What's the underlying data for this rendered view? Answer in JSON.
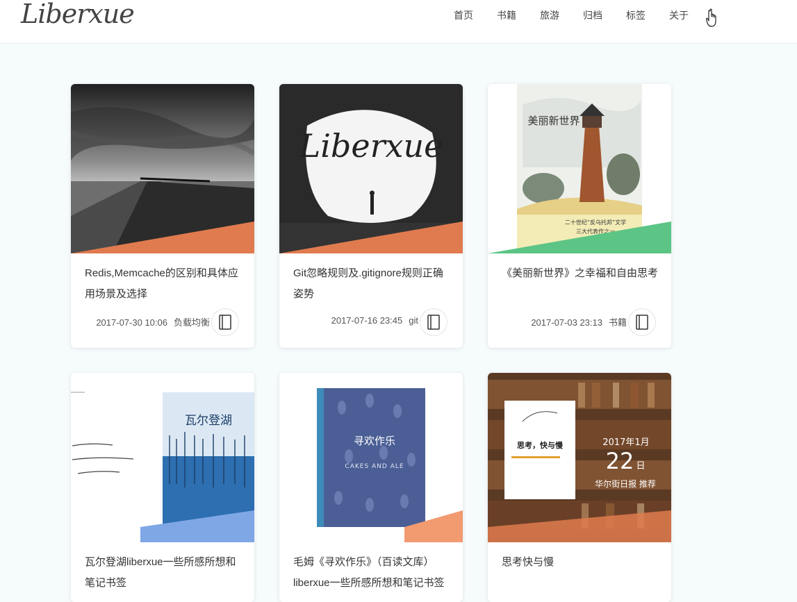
{
  "site": {
    "logo": "Liberxue"
  },
  "nav": [
    "首页",
    "书籍",
    "旅游",
    "归档",
    "标签",
    "关于"
  ],
  "posts": [
    {
      "title": "Redis,Memcache的区别和具体应用场景及选择",
      "date": "2017-07-30 10:06",
      "tag": "负载均衡"
    },
    {
      "title": "Git忽略规则及.gitignore规则正确姿势",
      "date": "2017-07-16 23:45",
      "tag": "git",
      "thumb_text": "Liberxue"
    },
    {
      "title": "《美丽新世界》之幸福和自由思考",
      "date": "2017-07-03 23:13",
      "tag": "书籍",
      "thumb_text": "美丽新世界",
      "thumb_sub": [
        "二十世纪“反乌托邦”文学",
        "三大代表作之一"
      ]
    },
    {
      "title": "瓦尔登湖liberxue一些所感所想和笔记书签",
      "thumb_text": "瓦尔登湖"
    },
    {
      "title": "毛姆《寻欢作乐》（百读文库）liberxue一些所感所想和笔记书签",
      "thumb_text": "寻欢作乐",
      "thumb_sub": [
        "CAKES AND ALE"
      ]
    },
    {
      "title": "思考快与慢",
      "thumb_text": "思考，快与慢",
      "thumb_sub": [
        "2017年1月",
        "22",
        "日",
        "华尔街日报  推荐"
      ]
    }
  ],
  "colors": {
    "accent_orange": "#e07b4f",
    "accent_green": "#5cc585",
    "accent_blue": "#7fa7e6",
    "background": "#f6fbfc"
  }
}
